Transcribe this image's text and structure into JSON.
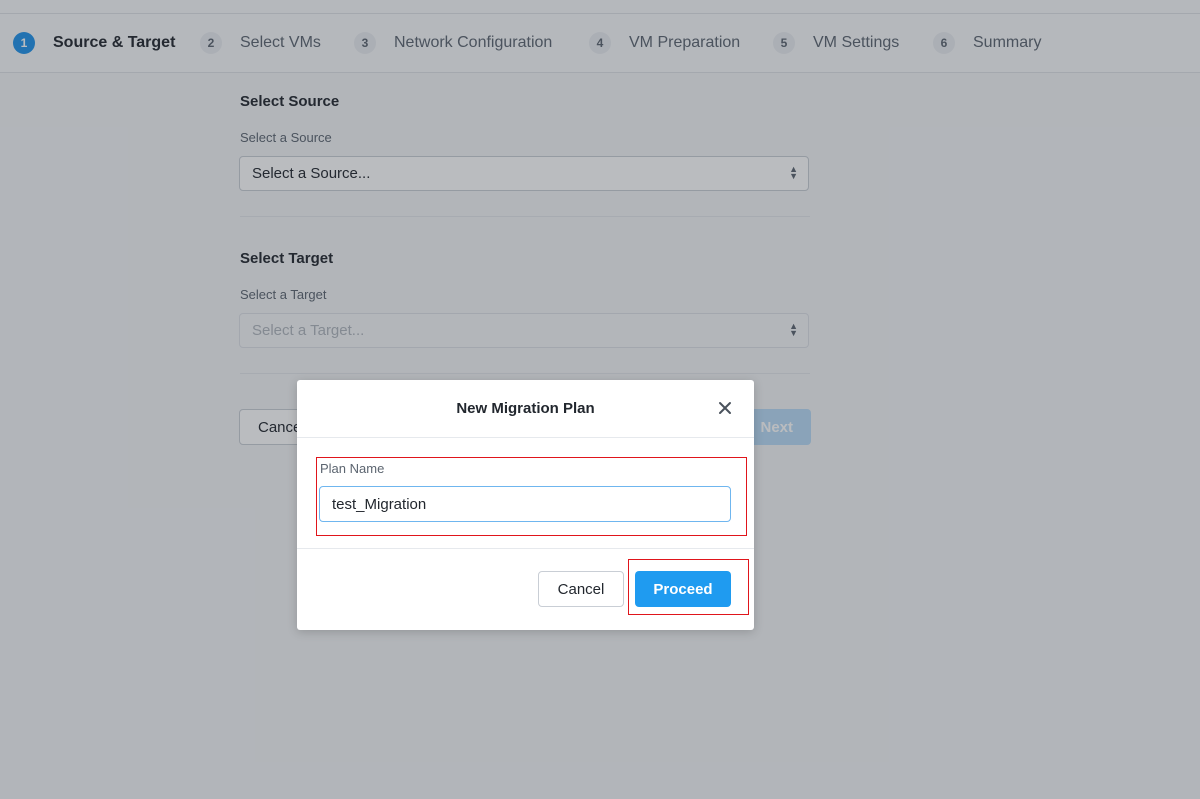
{
  "wizard": {
    "steps": [
      {
        "num": "1",
        "label": "Source & Target",
        "active": true
      },
      {
        "num": "2",
        "label": "Select VMs"
      },
      {
        "num": "3",
        "label": "Network Configuration"
      },
      {
        "num": "4",
        "label": "VM Preparation"
      },
      {
        "num": "5",
        "label": "VM Settings"
      },
      {
        "num": "6",
        "label": "Summary"
      }
    ]
  },
  "source": {
    "title": "Select Source",
    "label": "Select a Source",
    "placeholder": "Select a Source..."
  },
  "target": {
    "title": "Select Target",
    "label": "Select a Target",
    "placeholder": "Select a Target..."
  },
  "page_actions": {
    "cancel_label": "Cancel",
    "next_label": "Next"
  },
  "modal": {
    "title": "New Migration Plan",
    "plan_name_label": "Plan Name",
    "plan_name_value": "test_Migration",
    "cancel_label": "Cancel",
    "proceed_label": "Proceed"
  },
  "colors": {
    "accent": "#1f9bf0",
    "highlight": "#e0151b"
  },
  "icons": {
    "close": "close-icon",
    "select_caret": "updown-caret-icon"
  }
}
